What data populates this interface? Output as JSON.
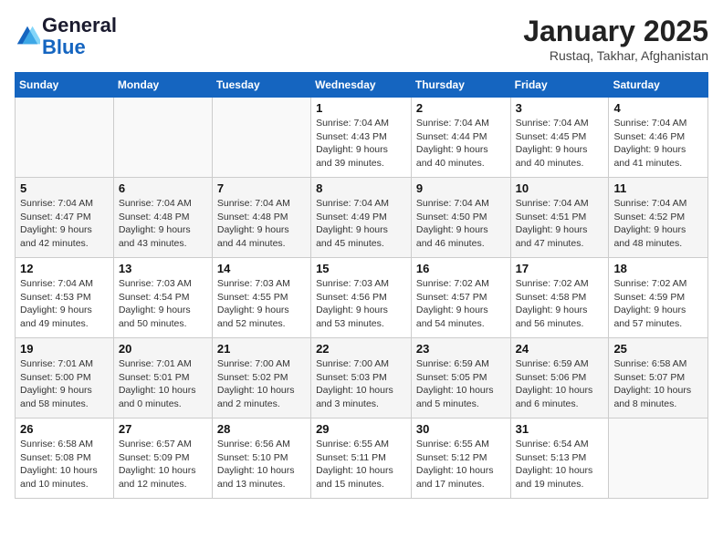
{
  "header": {
    "logo_line1": "General",
    "logo_line2": "Blue",
    "month": "January 2025",
    "location": "Rustaq, Takhar, Afghanistan"
  },
  "weekdays": [
    "Sunday",
    "Monday",
    "Tuesday",
    "Wednesday",
    "Thursday",
    "Friday",
    "Saturday"
  ],
  "weeks": [
    [
      {
        "day": "",
        "info": ""
      },
      {
        "day": "",
        "info": ""
      },
      {
        "day": "",
        "info": ""
      },
      {
        "day": "1",
        "info": "Sunrise: 7:04 AM\nSunset: 4:43 PM\nDaylight: 9 hours\nand 39 minutes."
      },
      {
        "day": "2",
        "info": "Sunrise: 7:04 AM\nSunset: 4:44 PM\nDaylight: 9 hours\nand 40 minutes."
      },
      {
        "day": "3",
        "info": "Sunrise: 7:04 AM\nSunset: 4:45 PM\nDaylight: 9 hours\nand 40 minutes."
      },
      {
        "day": "4",
        "info": "Sunrise: 7:04 AM\nSunset: 4:46 PM\nDaylight: 9 hours\nand 41 minutes."
      }
    ],
    [
      {
        "day": "5",
        "info": "Sunrise: 7:04 AM\nSunset: 4:47 PM\nDaylight: 9 hours\nand 42 minutes."
      },
      {
        "day": "6",
        "info": "Sunrise: 7:04 AM\nSunset: 4:48 PM\nDaylight: 9 hours\nand 43 minutes."
      },
      {
        "day": "7",
        "info": "Sunrise: 7:04 AM\nSunset: 4:48 PM\nDaylight: 9 hours\nand 44 minutes."
      },
      {
        "day": "8",
        "info": "Sunrise: 7:04 AM\nSunset: 4:49 PM\nDaylight: 9 hours\nand 45 minutes."
      },
      {
        "day": "9",
        "info": "Sunrise: 7:04 AM\nSunset: 4:50 PM\nDaylight: 9 hours\nand 46 minutes."
      },
      {
        "day": "10",
        "info": "Sunrise: 7:04 AM\nSunset: 4:51 PM\nDaylight: 9 hours\nand 47 minutes."
      },
      {
        "day": "11",
        "info": "Sunrise: 7:04 AM\nSunset: 4:52 PM\nDaylight: 9 hours\nand 48 minutes."
      }
    ],
    [
      {
        "day": "12",
        "info": "Sunrise: 7:04 AM\nSunset: 4:53 PM\nDaylight: 9 hours\nand 49 minutes."
      },
      {
        "day": "13",
        "info": "Sunrise: 7:03 AM\nSunset: 4:54 PM\nDaylight: 9 hours\nand 50 minutes."
      },
      {
        "day": "14",
        "info": "Sunrise: 7:03 AM\nSunset: 4:55 PM\nDaylight: 9 hours\nand 52 minutes."
      },
      {
        "day": "15",
        "info": "Sunrise: 7:03 AM\nSunset: 4:56 PM\nDaylight: 9 hours\nand 53 minutes."
      },
      {
        "day": "16",
        "info": "Sunrise: 7:02 AM\nSunset: 4:57 PM\nDaylight: 9 hours\nand 54 minutes."
      },
      {
        "day": "17",
        "info": "Sunrise: 7:02 AM\nSunset: 4:58 PM\nDaylight: 9 hours\nand 56 minutes."
      },
      {
        "day": "18",
        "info": "Sunrise: 7:02 AM\nSunset: 4:59 PM\nDaylight: 9 hours\nand 57 minutes."
      }
    ],
    [
      {
        "day": "19",
        "info": "Sunrise: 7:01 AM\nSunset: 5:00 PM\nDaylight: 9 hours\nand 58 minutes."
      },
      {
        "day": "20",
        "info": "Sunrise: 7:01 AM\nSunset: 5:01 PM\nDaylight: 10 hours\nand 0 minutes."
      },
      {
        "day": "21",
        "info": "Sunrise: 7:00 AM\nSunset: 5:02 PM\nDaylight: 10 hours\nand 2 minutes."
      },
      {
        "day": "22",
        "info": "Sunrise: 7:00 AM\nSunset: 5:03 PM\nDaylight: 10 hours\nand 3 minutes."
      },
      {
        "day": "23",
        "info": "Sunrise: 6:59 AM\nSunset: 5:05 PM\nDaylight: 10 hours\nand 5 minutes."
      },
      {
        "day": "24",
        "info": "Sunrise: 6:59 AM\nSunset: 5:06 PM\nDaylight: 10 hours\nand 6 minutes."
      },
      {
        "day": "25",
        "info": "Sunrise: 6:58 AM\nSunset: 5:07 PM\nDaylight: 10 hours\nand 8 minutes."
      }
    ],
    [
      {
        "day": "26",
        "info": "Sunrise: 6:58 AM\nSunset: 5:08 PM\nDaylight: 10 hours\nand 10 minutes."
      },
      {
        "day": "27",
        "info": "Sunrise: 6:57 AM\nSunset: 5:09 PM\nDaylight: 10 hours\nand 12 minutes."
      },
      {
        "day": "28",
        "info": "Sunrise: 6:56 AM\nSunset: 5:10 PM\nDaylight: 10 hours\nand 13 minutes."
      },
      {
        "day": "29",
        "info": "Sunrise: 6:55 AM\nSunset: 5:11 PM\nDaylight: 10 hours\nand 15 minutes."
      },
      {
        "day": "30",
        "info": "Sunrise: 6:55 AM\nSunset: 5:12 PM\nDaylight: 10 hours\nand 17 minutes."
      },
      {
        "day": "31",
        "info": "Sunrise: 6:54 AM\nSunset: 5:13 PM\nDaylight: 10 hours\nand 19 minutes."
      },
      {
        "day": "",
        "info": ""
      }
    ]
  ]
}
